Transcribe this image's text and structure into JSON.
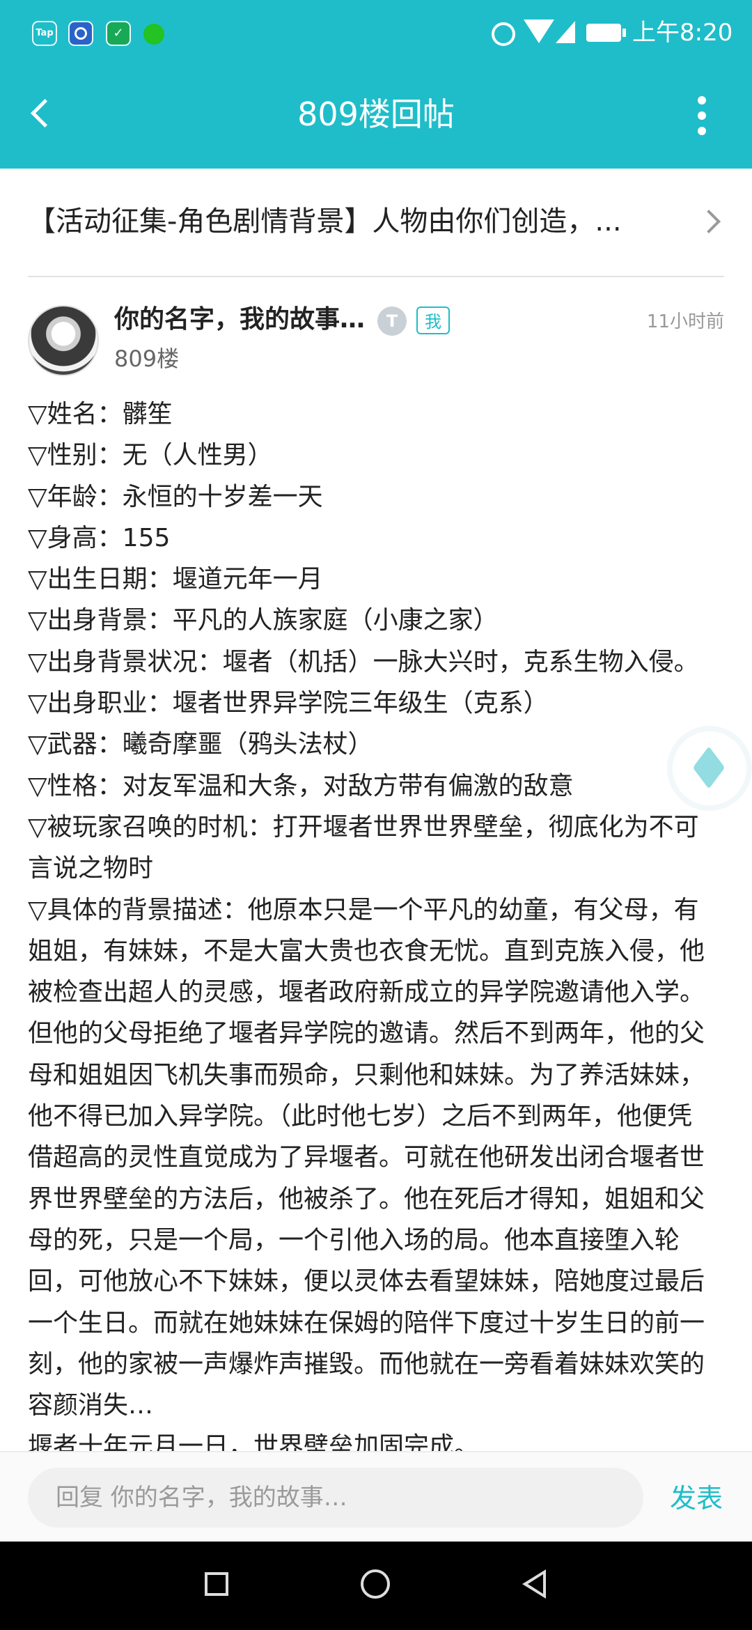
{
  "status_bar": {
    "app_icon_tap": "Tap",
    "time": "上午8:20",
    "icons": [
      "tap-app-icon",
      "blue-app-icon",
      "shield-app-icon",
      "green-dot-icon",
      "alarm-icon",
      "wifi-icon",
      "signal-icon",
      "battery-icon"
    ]
  },
  "header": {
    "title": "809楼回帖",
    "accent_color": "#1fbdc9"
  },
  "topic": {
    "title": "【活动征集-角色剧情背景】人物由你们创造，..."
  },
  "post": {
    "username": "你的名字，我的故事…",
    "level_badge": "T",
    "me_badge": "我",
    "time": "11小时前",
    "floor": "809楼",
    "lines": [
      "▽姓名：髒笙",
      "▽性别：无（人性男）",
      "▽年龄：永恒的十岁差一天",
      "▽身高：155",
      "▽出生日期：堰道元年一月",
      "▽出身背景：平凡的人族家庭（小康之家）",
      "▽出身背景状况：堰者（机括）一脉大兴时，克系生物入侵。",
      "▽出身职业：堰者世界异学院三年级生（克系）",
      "▽武器：曦奇摩噩（鸦头法杖）",
      "▽性格：对友军温和大条，对敌方带有偏激的敌意",
      "▽被玩家召唤的时机：打开堰者世界世界壁垒，彻底化为不可",
      "言说之物时",
      "▽具体的背景描述：他原本只是一个平凡的幼童，有父母，有",
      "姐姐，有妹妹，不是大富大贵也衣食无忧。直到克族入侵，他",
      "被检查出超人的灵感，堰者政府新成立的异学院邀请他入学。",
      "但他的父母拒绝了堰者异学院的邀请。然后不到两年，他的父",
      "母和姐姐因飞机失事而殒命，只剩他和妹妹。为了养活妹妹，",
      "他不得已加入异学院。（此时他七岁）之后不到两年，他便凭",
      "借超高的灵性直觉成为了异堰者。可就在他研发出闭合堰者世",
      "界世界壁垒的方法后，他被杀了。他在死后才得知，姐姐和父",
      "母的死，只是一个局，一个引他入场的局。他本直接堕入轮",
      "回，可他放心不下妹妹，便以灵体去看望妹妹，陪她度过最后",
      "一个生日。而就在她妹妹在保姆的陪伴下度过十岁生日的前一",
      "刻，他的家被一声爆炸声摧毁。而他就在一旁看着妹妹欢笑的",
      "容颜消失…",
      "  堰者十年元月一日，世界壁垒加固完成。"
    ]
  },
  "reply": {
    "placeholder": "回复 你的名字，我的故事…",
    "send_label": "发表"
  }
}
